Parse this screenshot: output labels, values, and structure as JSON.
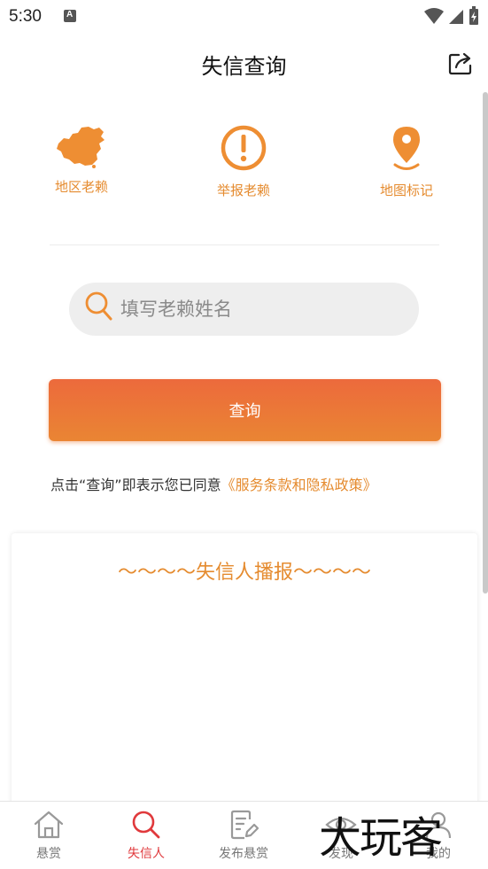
{
  "status": {
    "time": "5:30",
    "notification_icon": "A"
  },
  "header": {
    "title": "失信查询",
    "share_icon": "share-icon"
  },
  "quick_actions": [
    {
      "label": "地区老赖",
      "icon": "china-map-icon"
    },
    {
      "label": "举报老赖",
      "icon": "exclamation-circle-icon"
    },
    {
      "label": "地图标记",
      "icon": "map-pin-icon"
    }
  ],
  "search": {
    "placeholder": "填写老赖姓名",
    "value": ""
  },
  "query_button": {
    "label": "查询"
  },
  "agreement": {
    "prefix": "点击“查询”即表示您已同意",
    "link": "《服务条款和隐私政策》"
  },
  "broadcast": {
    "title": "～～～～失信人播报～～～～"
  },
  "bottom_nav": [
    {
      "label": "悬赏",
      "icon": "home-icon",
      "active": false
    },
    {
      "label": "失信人",
      "icon": "search-icon",
      "active": true
    },
    {
      "label": "发布悬赏",
      "icon": "edit-note-icon",
      "active": false
    },
    {
      "label": "发现",
      "icon": "eye-icon",
      "active": false
    },
    {
      "label": "我的",
      "icon": "user-icon",
      "active": false
    }
  ],
  "watermark": {
    "text": "大玩客"
  },
  "colors": {
    "accent": "#e58b2f",
    "button_top": "#ec6a3c",
    "button_bottom": "#ea8533",
    "nav_active": "#e0393c"
  }
}
